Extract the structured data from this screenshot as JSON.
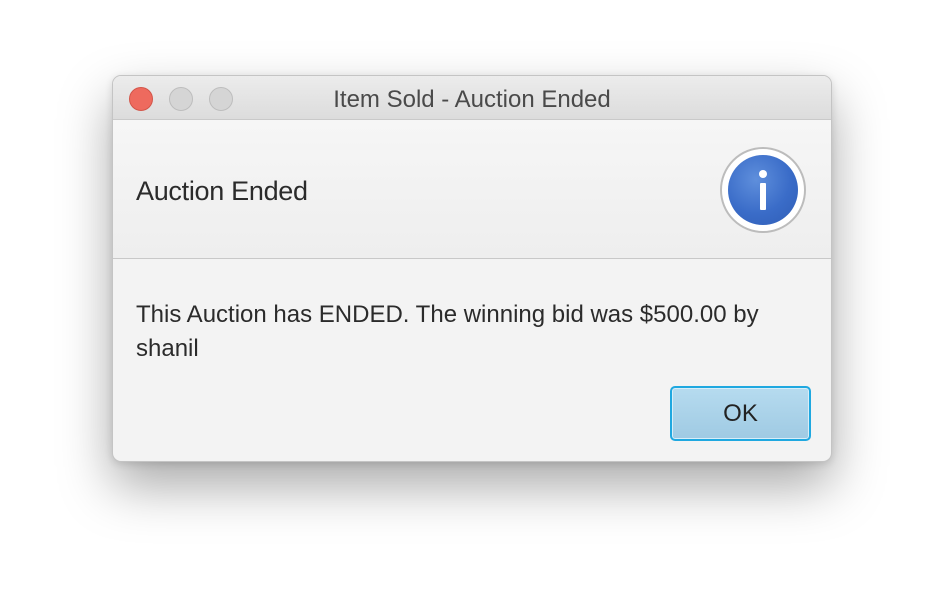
{
  "window": {
    "title": "Item Sold - Auction Ended",
    "controls": [
      "close",
      "minimize",
      "maximize"
    ]
  },
  "dialog": {
    "header_text": "Auction Ended",
    "icon": "info-icon",
    "message": "This Auction has ENDED. The winning bid was $500.00 by shanil",
    "ok_label": "OK"
  },
  "colors": {
    "close_button": "#ee6a5e",
    "info_icon": "#3a6cc8",
    "ok_focus_border": "#1fa8e0",
    "ok_fill": "#a9d2e9"
  }
}
